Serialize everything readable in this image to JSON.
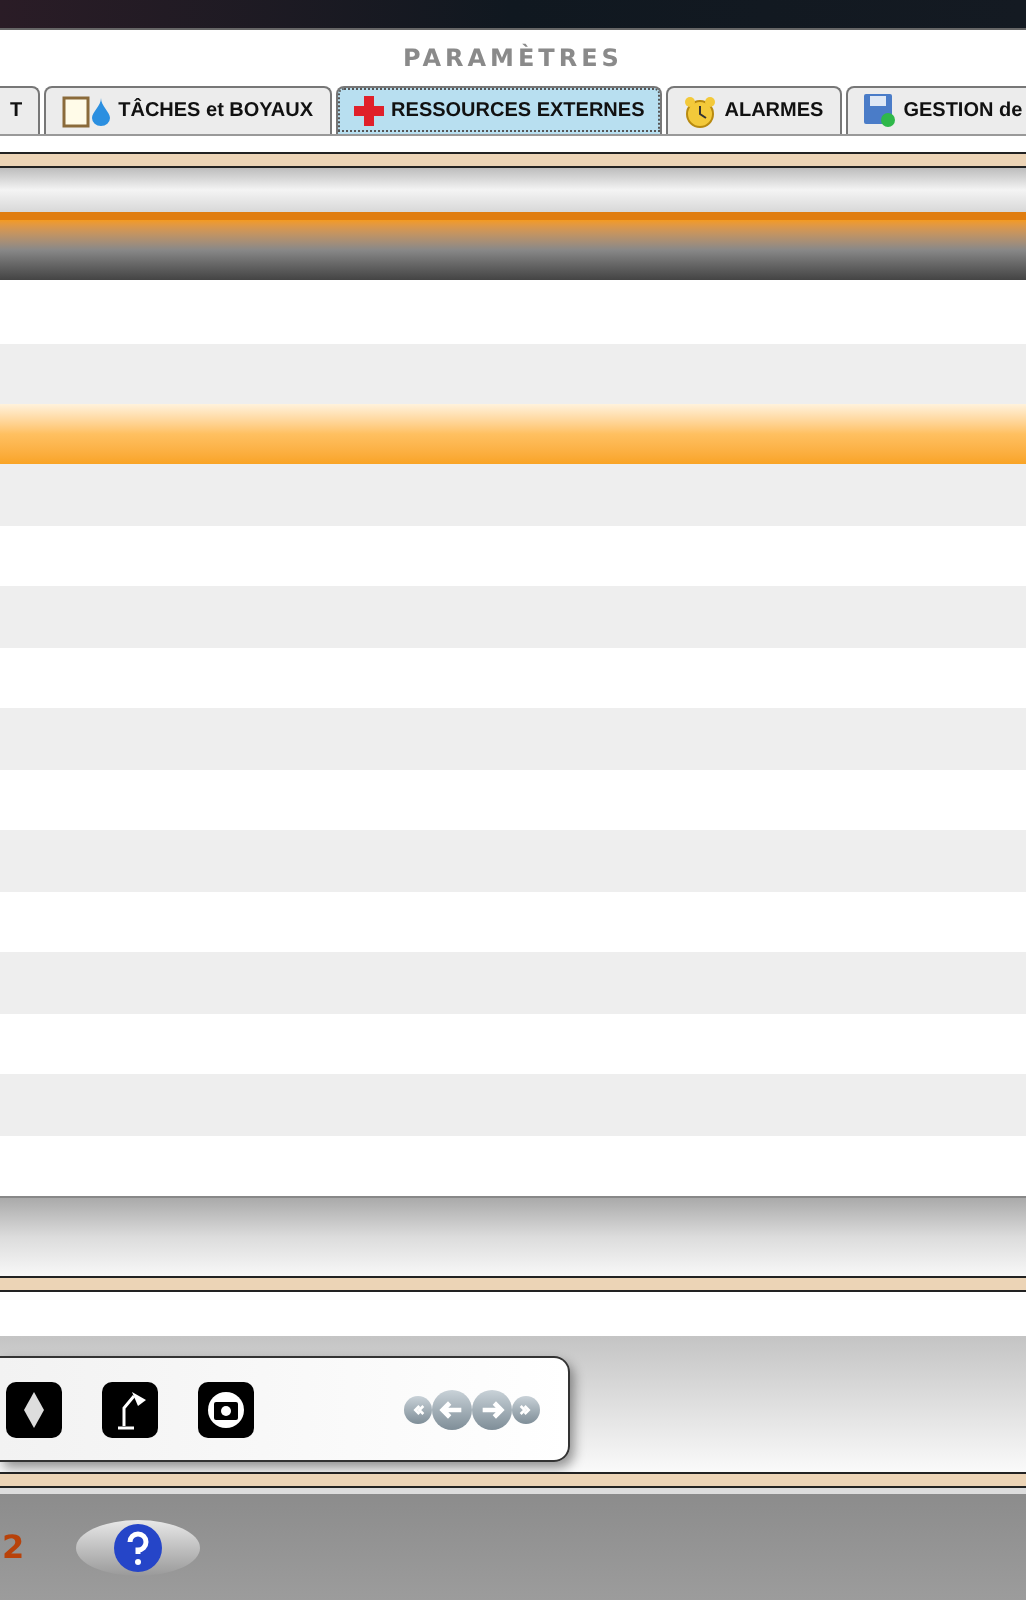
{
  "window": {
    "title": "PARAMÈTRES"
  },
  "tabs": [
    {
      "label": "T",
      "kind": "plain",
      "selected": false
    },
    {
      "label": "TÂCHES et BOYAUX",
      "kind": "tasks",
      "selected": false
    },
    {
      "label": "RESSOURCES EXTERNES",
      "kind": "external",
      "selected": true
    },
    {
      "label": "ALARMES",
      "kind": "alarms",
      "selected": false
    },
    {
      "label": "GESTION de",
      "kind": "management",
      "selected": false
    }
  ],
  "footer": {
    "page_number": "2"
  }
}
